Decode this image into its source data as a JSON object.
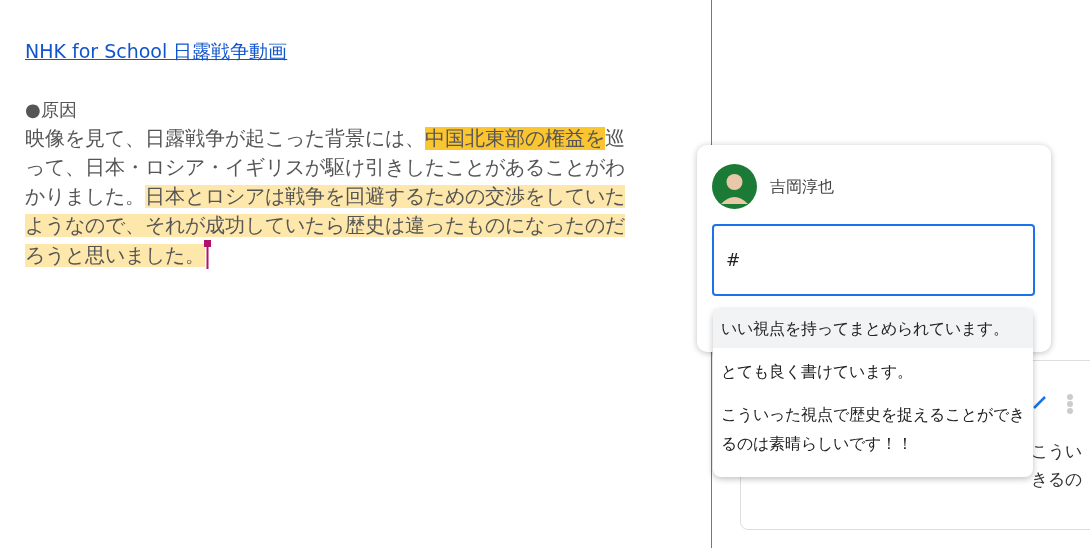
{
  "document": {
    "link": "NHK for School 日露戦争動画",
    "heading": "●原因",
    "segments": [
      {
        "text": "映像を見て、日露戦争が起こった背景には、"
      },
      {
        "text": "中国北東部の権益を",
        "color": "#fbc531"
      },
      {
        "text": "巡って、日本・ロシア・イギリスが駆け引きしたことがあることがわかりました。"
      },
      {
        "text": "日本とロシアは戦争を回避するための交渉をしていたようなので、それが成功していたら歴史は違ったものになったのだろうと思いました。",
        "color": "#fde7ab"
      }
    ]
  },
  "comment_box": {
    "author": "吉岡淳也",
    "value": "#",
    "suggestions": [
      {
        "text": "いい視点を持ってまとめられています。",
        "selected": true
      },
      {
        "text": "とても良く書けています。",
        "selected": false
      },
      {
        "text": "こういった視点で歴史を捉えることができるのは素晴らしいです！！",
        "selected": false
      }
    ]
  },
  "comment_behind": {
    "lines": [
      "こうい",
      "きるの"
    ]
  }
}
